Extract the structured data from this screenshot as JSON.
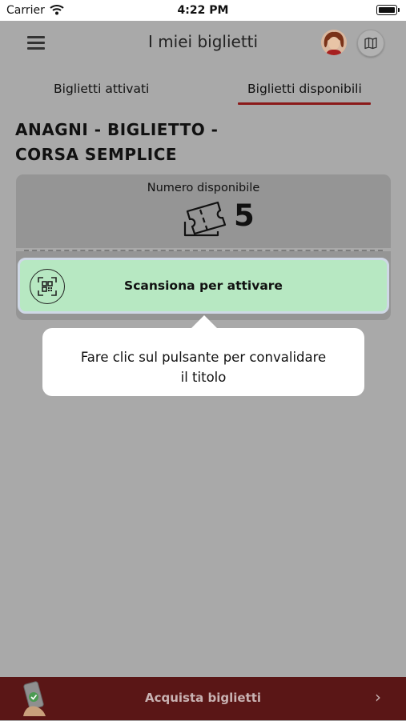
{
  "status_bar": {
    "carrier": "Carrier",
    "time": "4:22 PM"
  },
  "header": {
    "title": "I miei biglietti",
    "menu_icon": "hamburger-menu-icon",
    "map_icon": "map-icon"
  },
  "tabs": [
    {
      "label": "Biglietti attivati",
      "active": false
    },
    {
      "label": "Biglietti disponibili",
      "active": true
    }
  ],
  "ticket": {
    "title_line1": "ANAGNI - BIGLIETTO -",
    "title_line2": "CORSA SEMPLICE",
    "available_label": "Numero disponibile",
    "available_count": "5",
    "scan_button_label": "Scansiona per attivare"
  },
  "tooltip": {
    "line1": "Fare clic sul pulsante per convalidare",
    "line2": "il titolo"
  },
  "footer": {
    "buy_label": "Acquista biglietti",
    "chevron": "›"
  },
  "colors": {
    "accent": "#8b1a1a",
    "scan_button": "#b7e8c2",
    "footer_bg": "#5a1616",
    "overlay": "#a9a9a9"
  }
}
